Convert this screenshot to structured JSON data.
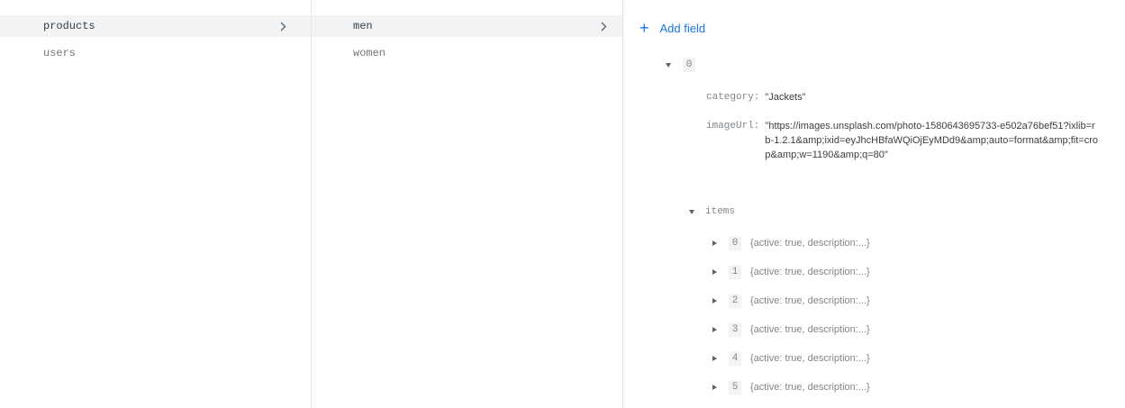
{
  "collections": {
    "items": [
      {
        "label": "products",
        "selected": true
      },
      {
        "label": "users",
        "selected": false
      }
    ]
  },
  "documents": {
    "items": [
      {
        "label": "men",
        "selected": true
      },
      {
        "label": "women",
        "selected": false
      }
    ]
  },
  "fields": {
    "add_field_label": "Add field",
    "root_index": "0",
    "category": {
      "key": "category:",
      "value": "\"Jackets\""
    },
    "imageUrl": {
      "key": "imageUrl:",
      "value": "\"https://images.unsplash.com/photo-1580643695733-e502a76bef51?ixlib=rb-1.2.1&amp;ixid=eyJhcHBfaWQiOjEyMDd9&amp;auto=format&amp;fit=crop&amp;w=1190&amp;q=80\""
    },
    "items_key": "items",
    "items": [
      {
        "index": "0",
        "summary": "{active: true, description:...}"
      },
      {
        "index": "1",
        "summary": "{active: true, description:...}"
      },
      {
        "index": "2",
        "summary": "{active: true, description:...}"
      },
      {
        "index": "3",
        "summary": "{active: true, description:...}"
      },
      {
        "index": "4",
        "summary": "{active: true, description:...}"
      },
      {
        "index": "5",
        "summary": "{active: true, description:...}"
      }
    ]
  }
}
